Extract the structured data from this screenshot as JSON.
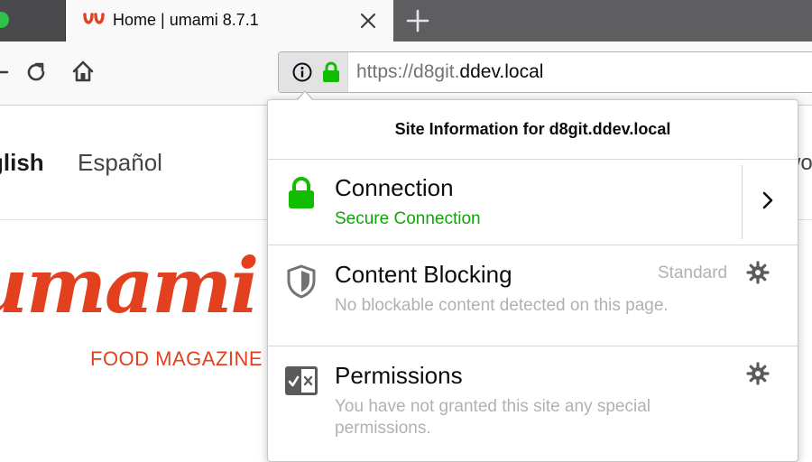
{
  "browser": {
    "active_tab": {
      "title": "Home | umami 8.7.1"
    },
    "url": {
      "prefix": "https://d8git.",
      "host": "ddev.local"
    }
  },
  "page": {
    "languages": {
      "english": "glish",
      "espanol": "Español",
      "cut": "wo"
    },
    "logo": {
      "word": "umami",
      "tagline": "FOOD MAGAZINE"
    }
  },
  "site_info_panel": {
    "title": "Site Information for d8git.ddev.local",
    "connection": {
      "label": "Connection",
      "status": "Secure Connection"
    },
    "content_blocking": {
      "label": "Content Blocking",
      "level": "Standard",
      "description": "No blockable content detected on this page."
    },
    "permissions": {
      "label": "Permissions",
      "description": "You have not granted this site any special permissions."
    }
  },
  "colors": {
    "brand": "#e3401f",
    "secure_green": "#0ea60b",
    "muted_text": "#b1b1b3"
  },
  "icons": [
    "umami-favicon-icon",
    "close-icon",
    "plus-icon",
    "back-icon",
    "reload-icon",
    "home-icon",
    "info-icon",
    "lock-icon",
    "chevron-right-icon",
    "shield-icon",
    "gear-icon",
    "permissions-icon"
  ]
}
